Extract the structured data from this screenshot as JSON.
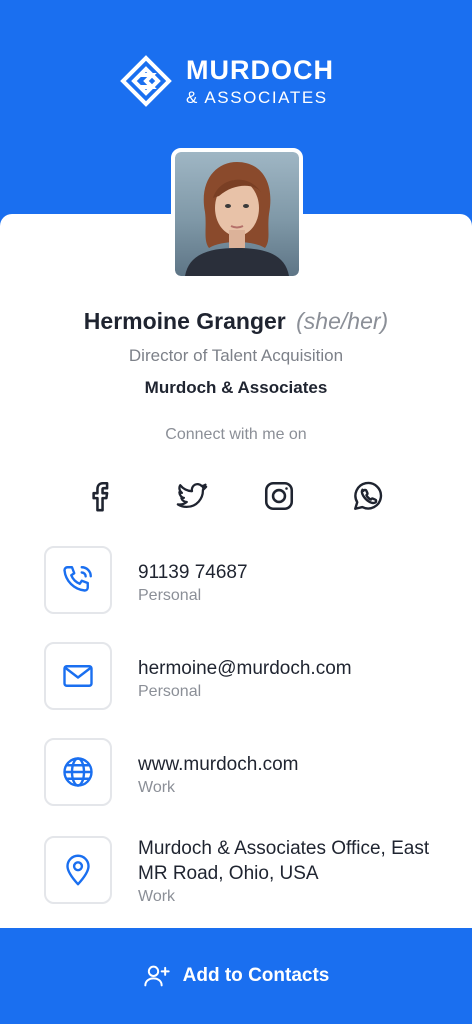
{
  "brand": {
    "title": "MURDOCH",
    "subtitle": "& ASSOCIATES",
    "color": "#1a6ff0"
  },
  "profile": {
    "name": "Hermoine Granger",
    "pronouns": "(she/her)",
    "job_title": "Director of Talent Acquisition",
    "company": "Murdoch & Associates"
  },
  "connect": {
    "heading": "Connect with me on",
    "networks": [
      "facebook-icon",
      "twitter-icon",
      "instagram-icon",
      "whatsapp-icon"
    ]
  },
  "contacts": [
    {
      "icon": "phone-icon",
      "value": "91139 74687",
      "label": "Personal"
    },
    {
      "icon": "mail-icon",
      "value": "hermoine@murdoch.com",
      "label": "Personal"
    },
    {
      "icon": "globe-icon",
      "value": "www.murdoch.com",
      "label": "Work"
    },
    {
      "icon": "location-pin-icon",
      "value": "Murdoch & Associates Office, East MR Road, Ohio, USA",
      "label": "Work"
    }
  ],
  "footer": {
    "button_label": "Add to Contacts",
    "icon": "add-user-icon"
  }
}
